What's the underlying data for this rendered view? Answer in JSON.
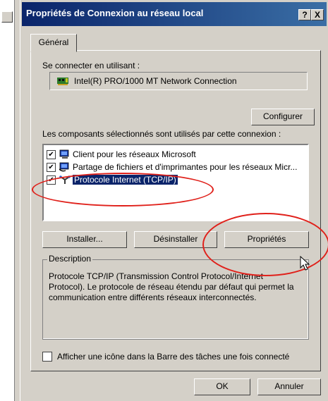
{
  "window": {
    "title": "Propriétés de Connexion au réseau local",
    "help_label": "?",
    "close_label": "X"
  },
  "tabs": [
    {
      "label": "Général"
    }
  ],
  "general": {
    "connect_using_label": "Se connecter en utilisant :",
    "adapter_name": "Intel(R) PRO/1000 MT Network Connection",
    "configure_label": "Configurer",
    "components_label": "Les composants sélectionnés sont utilisés par cette connexion :",
    "components": [
      {
        "label": "Client pour les réseaux Microsoft",
        "checked": true,
        "icon": "client-icon"
      },
      {
        "label": "Partage de fichiers et d'imprimantes pour les réseaux Micr...",
        "checked": true,
        "icon": "share-icon"
      },
      {
        "label": "Protocole Internet (TCP/IP)",
        "checked": true,
        "selected": true,
        "icon": "protocol-icon"
      }
    ],
    "install_label": "Installer...",
    "uninstall_label": "Désinstaller",
    "properties_label": "Propriétés",
    "description_group_label": "Description",
    "description_text": "Protocole TCP/IP (Transmission Control Protocol/Internet Protocol). Le protocole de réseau étendu par défaut qui permet la communication entre différents réseaux interconnectés.",
    "show_icon_label": "Afficher une icône dans la Barre des tâches une fois connecté",
    "show_icon_checked": false
  },
  "footer": {
    "ok_label": "OK",
    "cancel_label": "Annuler"
  },
  "colors": {
    "titlebar": "#0a246a",
    "annotation": "#e0201a",
    "face": "#d4d0c8"
  }
}
